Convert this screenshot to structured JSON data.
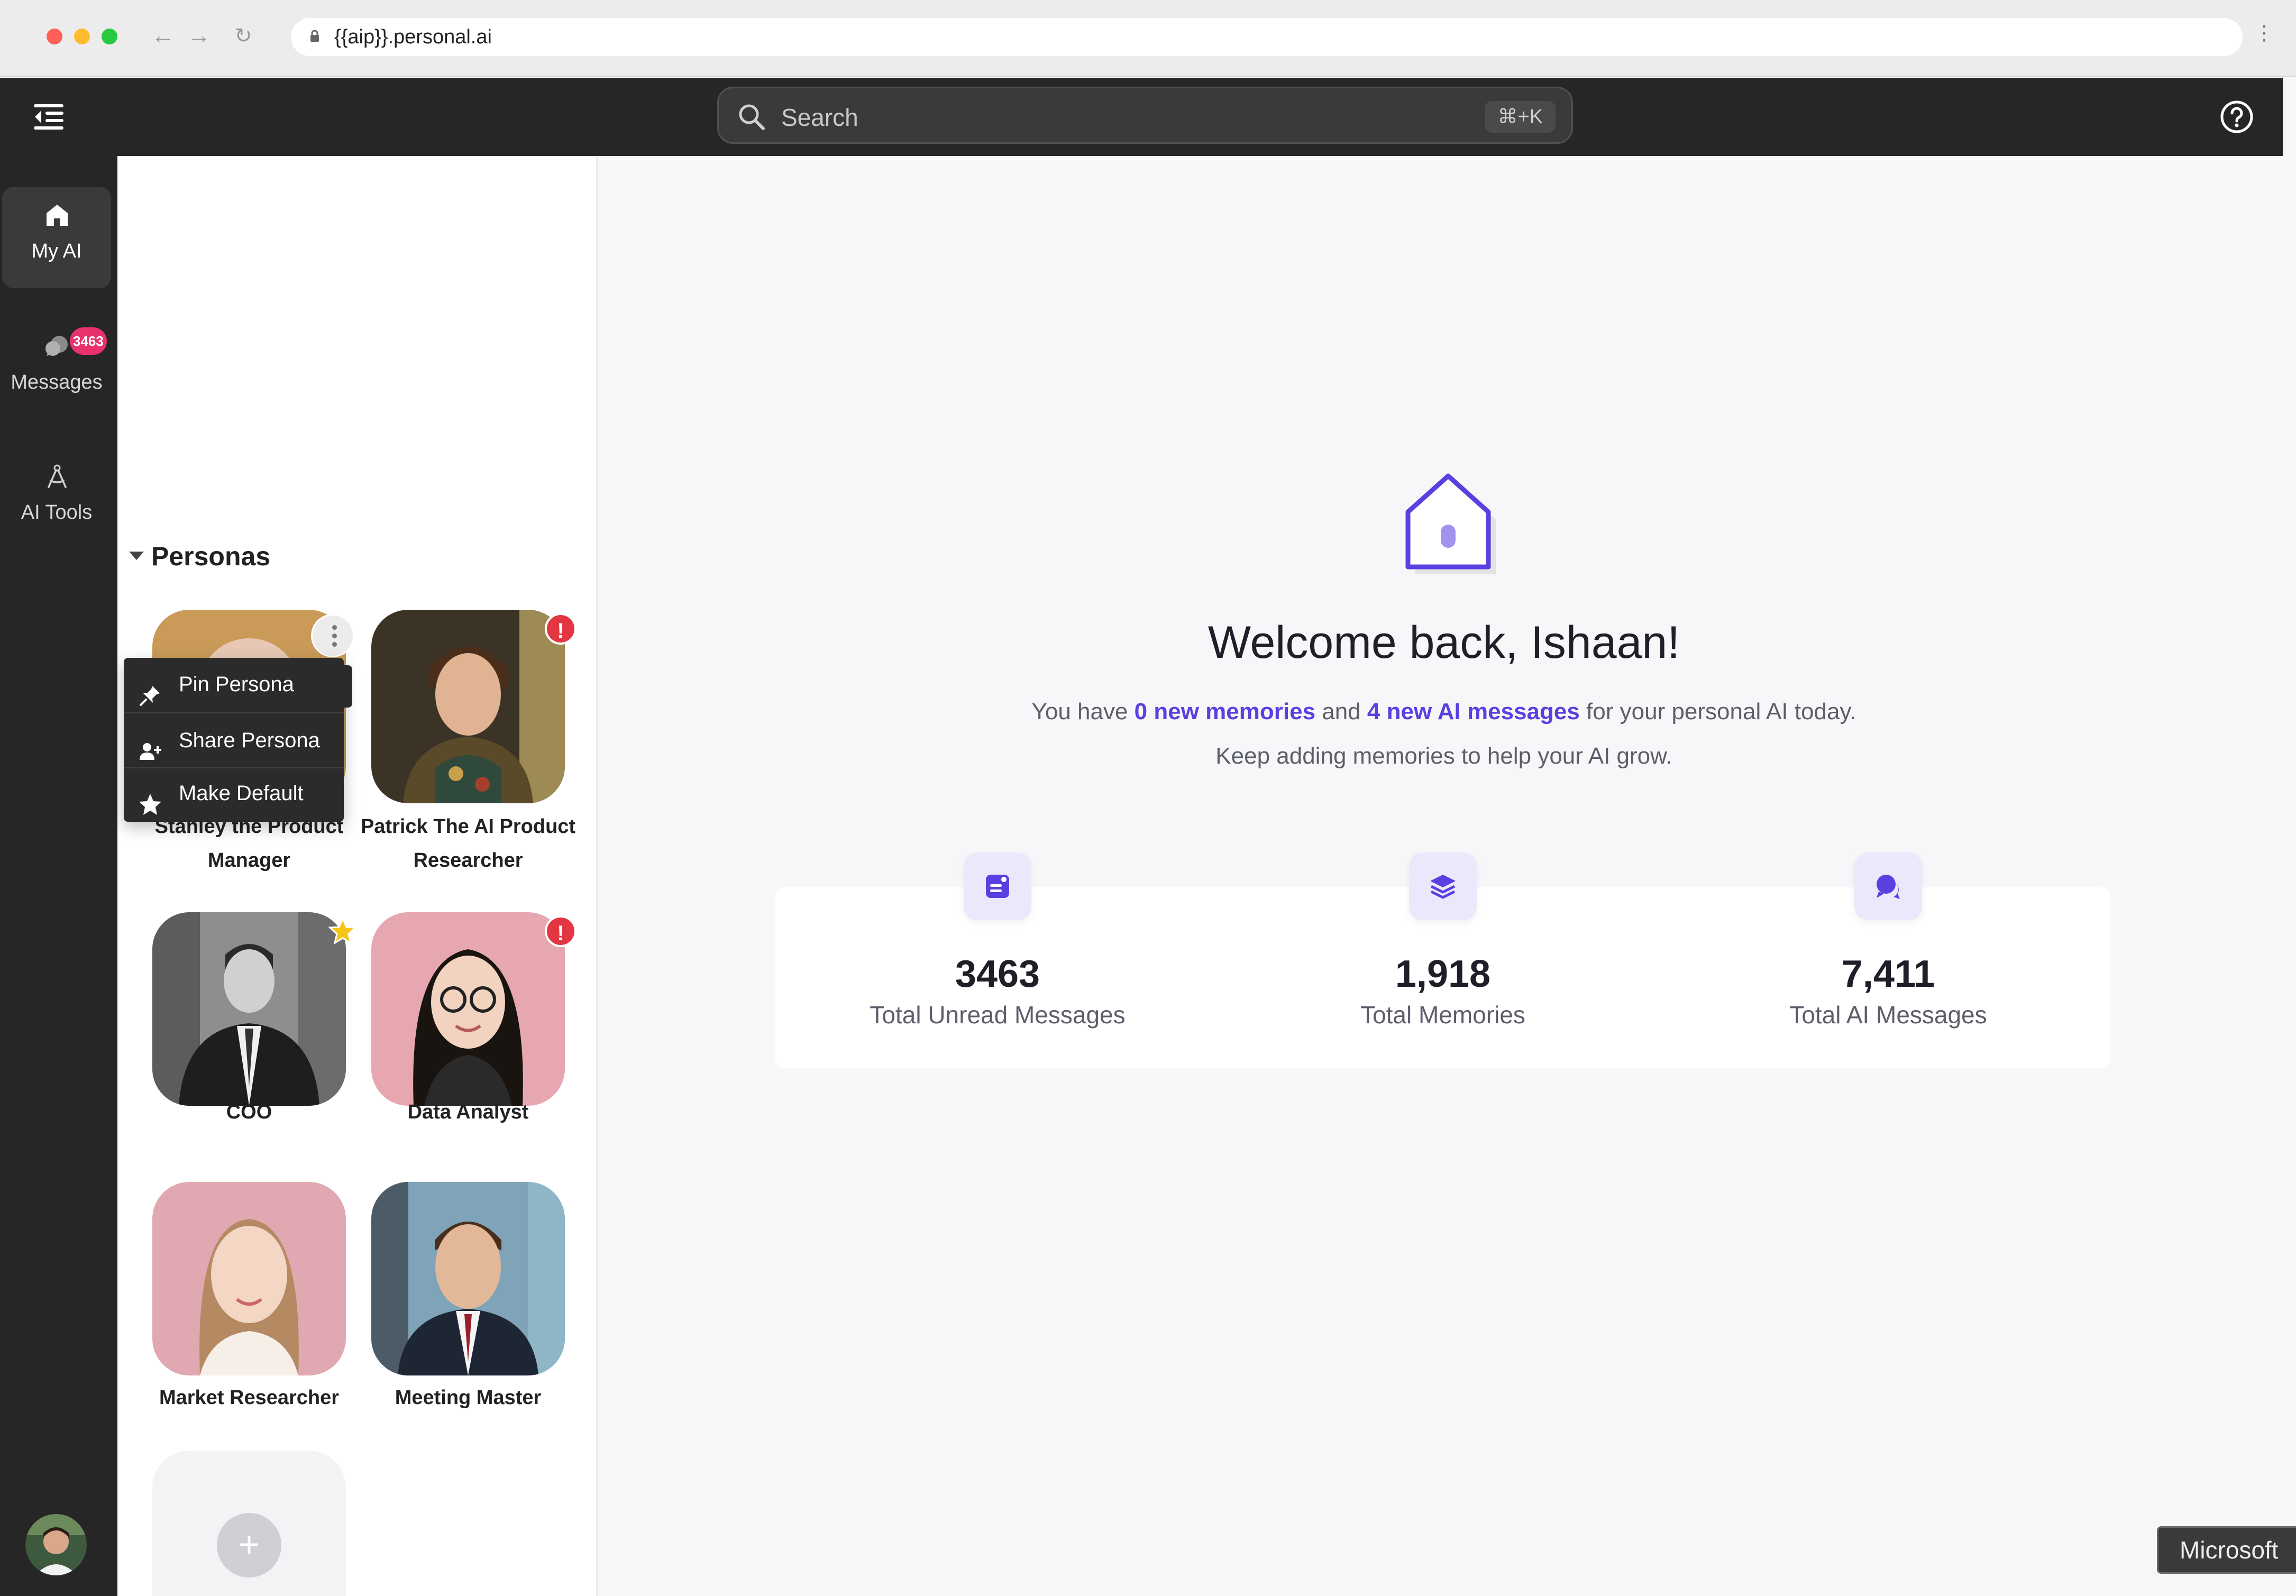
{
  "browser": {
    "url": "{{aip}}.personal.ai"
  },
  "header": {
    "search_placeholder": "Search",
    "search_shortcut": "⌘+K"
  },
  "rail": {
    "items": [
      {
        "label": "My AI",
        "icon": "home-icon",
        "active": true
      },
      {
        "label": "Messages",
        "icon": "chat-bubbles-icon",
        "badge": "3463"
      },
      {
        "label": "AI Tools",
        "icon": "compass-tool-icon"
      }
    ]
  },
  "personas": {
    "section_title": "Personas",
    "cards": [
      {
        "name": "Stanley the Product Manager",
        "status": "menu-open"
      },
      {
        "name": "Patrick The AI Product Researcher",
        "status": "alert",
        "alert_symbol": "!"
      },
      {
        "name": "COO",
        "status": "default-star"
      },
      {
        "name": "Data Analyst",
        "status": "alert",
        "alert_symbol": "!"
      },
      {
        "name": "Market Researcher"
      },
      {
        "name": "Meeting Master"
      }
    ],
    "add_symbol": "+",
    "context_menu": [
      {
        "label": "Pin Persona",
        "icon": "pin-icon"
      },
      {
        "label": "Share Persona",
        "icon": "add-user-icon"
      },
      {
        "label": "Make Default",
        "icon": "star-icon"
      }
    ]
  },
  "welcome": {
    "title": "Welcome back, Ishaan!",
    "line1_prefix": "You have ",
    "line1_memories": "0 new memories",
    "line1_and": " and ",
    "line1_messages": "4 new AI messages",
    "line1_suffix": " for your personal AI today.",
    "line2": "Keep adding memories to help your AI grow."
  },
  "stats": [
    {
      "value": "3463",
      "label": "Total Unread Messages",
      "icon": "note-icon"
    },
    {
      "value": "1,918",
      "label": "Total Memories",
      "icon": "layers-icon"
    },
    {
      "value": "7,411",
      "label": "Total AI Messages",
      "icon": "chat-icon"
    }
  ],
  "toast": {
    "text": "Microsoft"
  },
  "colors": {
    "accent": "#5b3fe0",
    "header_bg": "#262626",
    "alert": "#e23742",
    "badge": "#e8326b",
    "star": "#f5c518"
  }
}
